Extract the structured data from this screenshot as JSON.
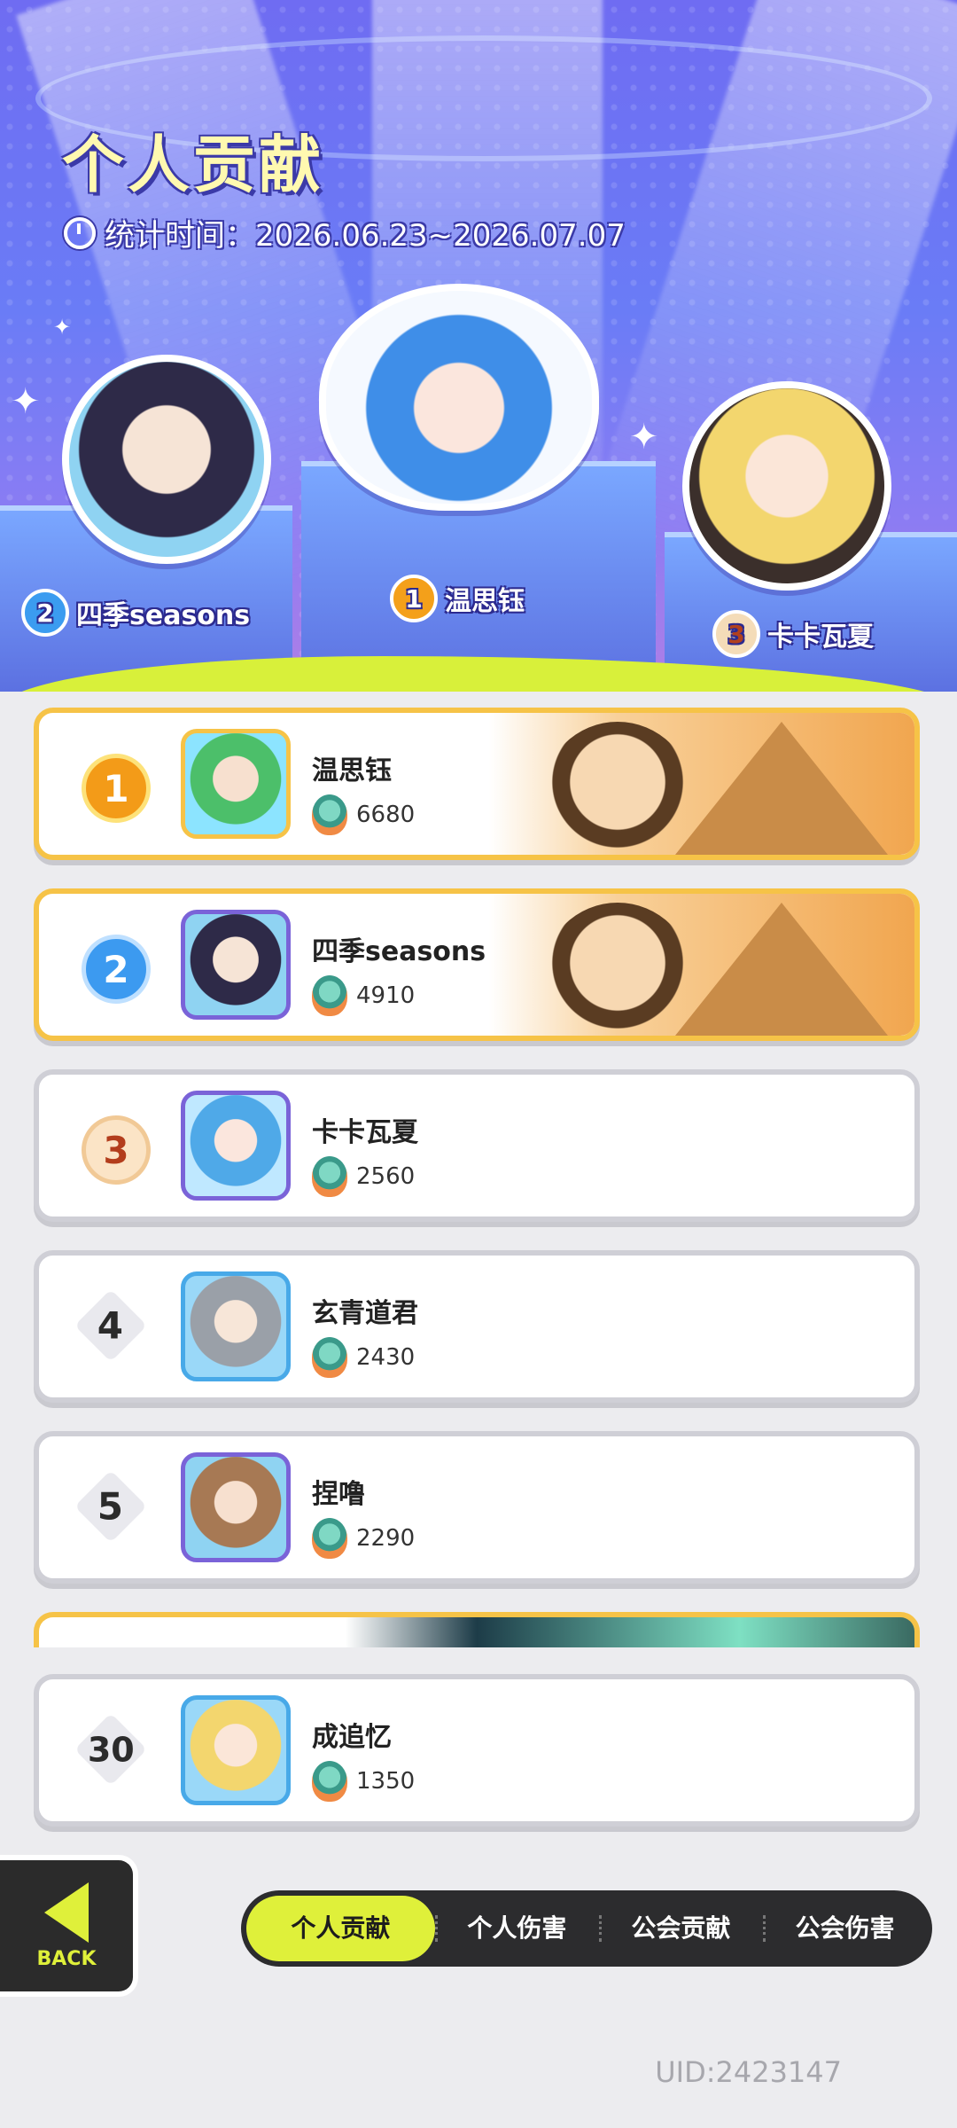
{
  "header": {
    "title": "个人贡献",
    "period_label": "统计时间：2026.06.23~2026.07.07"
  },
  "podium": [
    {
      "rank": "2",
      "name": "四季seasons"
    },
    {
      "rank": "1",
      "name": "温思钰"
    },
    {
      "rank": "3",
      "name": "卡卡瓦夏"
    }
  ],
  "leaderboard": [
    {
      "rank": "1",
      "name": "温思钰",
      "score": "6680"
    },
    {
      "rank": "2",
      "name": "四季seasons",
      "score": "4910"
    },
    {
      "rank": "3",
      "name": "卡卡瓦夏",
      "score": "2560"
    },
    {
      "rank": "4",
      "name": "玄青道君",
      "score": "2430"
    },
    {
      "rank": "5",
      "name": "捏噜",
      "score": "2290"
    }
  ],
  "self_entry": {
    "rank": "30",
    "name": "成追忆",
    "score": "1350"
  },
  "nav": {
    "back_label": "BACK",
    "tabs": [
      "个人贡献",
      "个人伤害",
      "公会贡献",
      "公会伤害"
    ],
    "active_tab": "个人贡献"
  },
  "footer": {
    "uid": "UID:2423147"
  },
  "icons": [
    "clock-icon",
    "rank-medal-icon",
    "contribution-gem-icon",
    "back-arrow-icon"
  ],
  "colors": {
    "accent": "#dff03a",
    "header_bg": "#6f6cf2",
    "gold_border": "#f6c347"
  }
}
